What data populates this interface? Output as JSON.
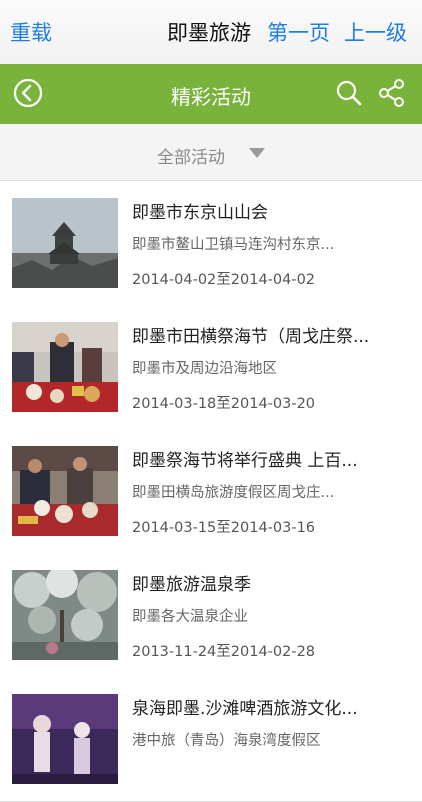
{
  "nav": {
    "reload_label": "重载",
    "title": "即墨旅游",
    "first_page_label": "第一页",
    "up_level_label": "上一级"
  },
  "appbar": {
    "title": "精彩活动",
    "accent_color": "#7ab33c",
    "icons": [
      "back-icon",
      "search-icon",
      "share-icon"
    ]
  },
  "filter": {
    "selected": "全部活动"
  },
  "events": [
    {
      "title": "即墨市东京山山会",
      "location": "即墨市鳌山卫镇马连沟村东京...",
      "dates": "2014-04-02至2014-04-02"
    },
    {
      "title": "即墨市田横祭海节（周戈庄祭...",
      "location": "即墨市及周边沿海地区",
      "dates": "2014-03-18至2014-03-20"
    },
    {
      "title": "即墨祭海节将举行盛典 上百...",
      "location": "即墨田横岛旅游度假区周戈庄...",
      "dates": "2014-03-15至2014-03-16"
    },
    {
      "title": "即墨旅游温泉季",
      "location": "即墨各大温泉企业",
      "dates": "2013-11-24至2014-02-28"
    },
    {
      "title": "泉海即墨.沙滩啤酒旅游文化...",
      "location": "港中旅（青岛）海泉湾度假区",
      "dates": ""
    }
  ]
}
